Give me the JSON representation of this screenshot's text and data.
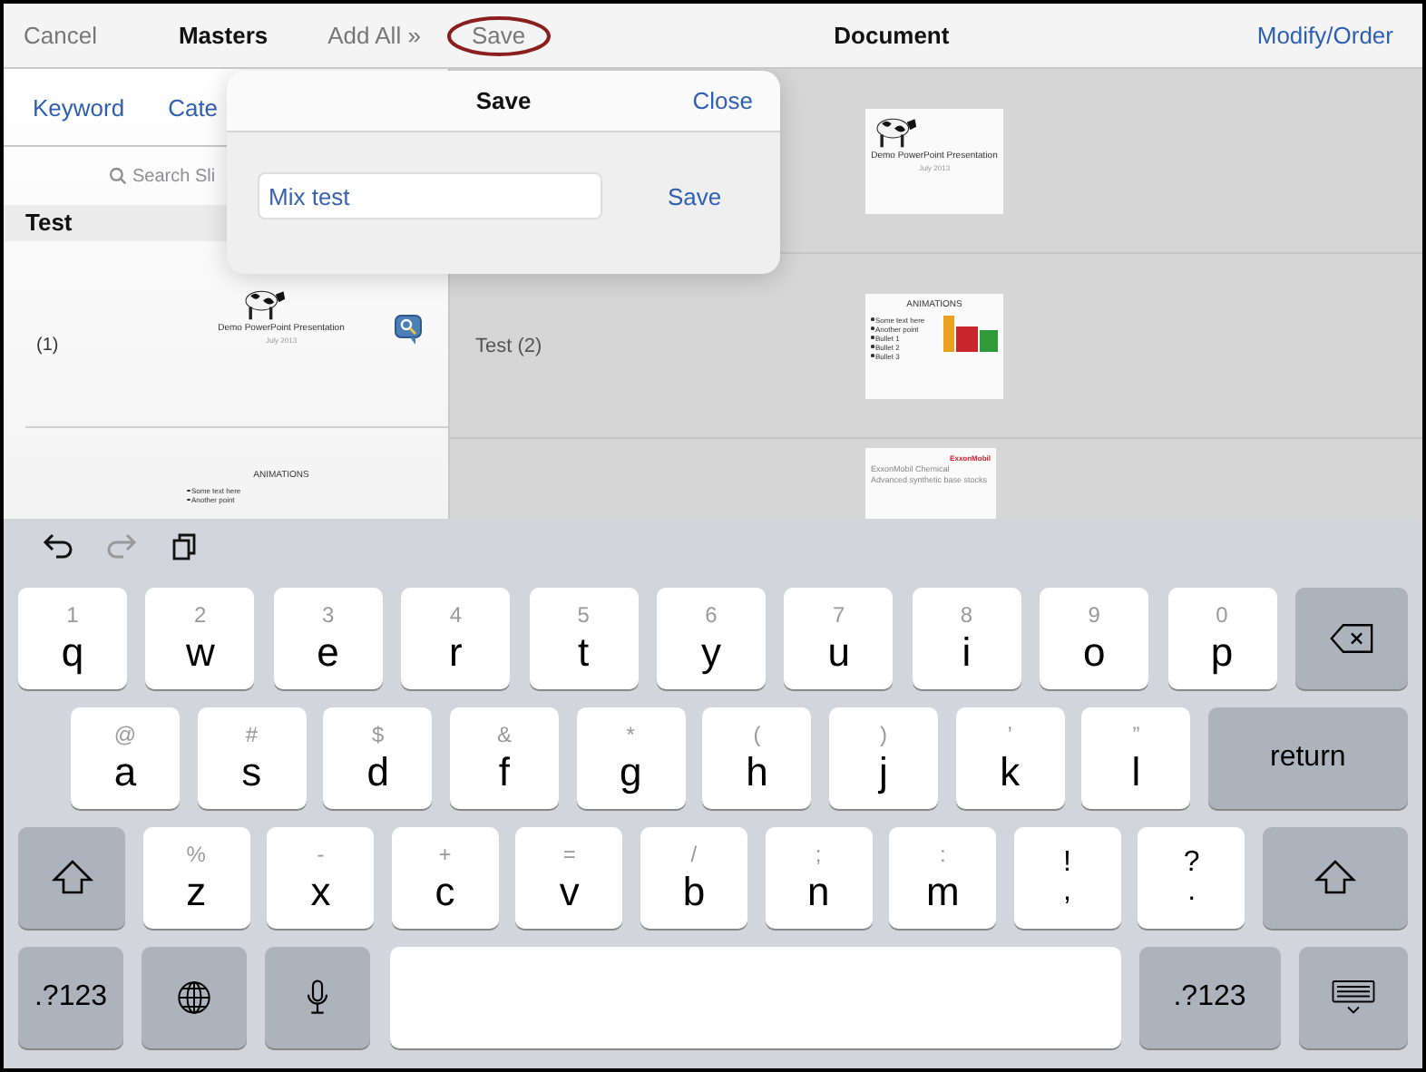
{
  "top_bar": {
    "cancel": "Cancel",
    "masters": "Masters",
    "add_all": "Add All »",
    "save": "Save",
    "save_highlighted": true,
    "document": "Document",
    "modify_order": "Modify/Order"
  },
  "filter_tabs": [
    "Keyword",
    "Cate"
  ],
  "search": {
    "placeholder": "Search Sli"
  },
  "section": "Test",
  "left_rows": [
    {
      "number": "(1)",
      "slide": {
        "kind": "title",
        "title": "Demo PowerPoint Presentation",
        "subtitle": "July 2013"
      }
    },
    {
      "slide": {
        "kind": "bullets",
        "title": "ANIMATIONS",
        "bullets": [
          "Some text here",
          "Another point"
        ]
      }
    }
  ],
  "right_rows": [
    {
      "slide": {
        "kind": "title",
        "title": "Demo PowerPoint Presentation",
        "subtitle": "July 2013"
      }
    },
    {
      "label": "Test (2)",
      "slide": {
        "kind": "bullets",
        "title": "ANIMATIONS",
        "bullets": [
          "Some text here",
          "Another point",
          "Bullet 1",
          "Bullet 2",
          "Bullet 3"
        ]
      }
    },
    {
      "slide": {
        "kind": "cover",
        "logo": "ExxonMobil",
        "title": "ExxonMobil Chemical",
        "subtitle": "Advanced synthetic base stocks"
      }
    }
  ],
  "popover": {
    "title": "Save",
    "close": "Close",
    "name_value": "Mix test",
    "save": "Save"
  },
  "keyboard": {
    "toolbar": [
      {
        "kind": "undo",
        "disabled": false
      },
      {
        "kind": "redo",
        "disabled": true
      },
      {
        "kind": "paste",
        "disabled": false
      }
    ],
    "rows": [
      {
        "keys": [
          {
            "kind": "letter",
            "main": "q",
            "alt": "1"
          },
          {
            "kind": "letter",
            "main": "w",
            "alt": "2"
          },
          {
            "kind": "letter",
            "main": "e",
            "alt": "3"
          },
          {
            "kind": "letter",
            "main": "r",
            "alt": "4"
          },
          {
            "kind": "letter",
            "main": "t",
            "alt": "5"
          },
          {
            "kind": "letter",
            "main": "y",
            "alt": "6"
          },
          {
            "kind": "letter",
            "main": "u",
            "alt": "7"
          },
          {
            "kind": "letter",
            "main": "i",
            "alt": "8"
          },
          {
            "kind": "letter",
            "main": "o",
            "alt": "9"
          },
          {
            "kind": "letter",
            "main": "p",
            "alt": "0"
          },
          {
            "kind": "delete"
          }
        ]
      },
      {
        "keys": [
          {
            "kind": "letter",
            "main": "a",
            "alt": "@"
          },
          {
            "kind": "letter",
            "main": "s",
            "alt": "#"
          },
          {
            "kind": "letter",
            "main": "d",
            "alt": "$"
          },
          {
            "kind": "letter",
            "main": "f",
            "alt": "&"
          },
          {
            "kind": "letter",
            "main": "g",
            "alt": "*"
          },
          {
            "kind": "letter",
            "main": "h",
            "alt": "("
          },
          {
            "kind": "letter",
            "main": "j",
            "alt": ")"
          },
          {
            "kind": "letter",
            "main": "k",
            "alt": "’"
          },
          {
            "kind": "letter",
            "main": "l",
            "alt": "”"
          },
          {
            "kind": "label",
            "main": "return"
          }
        ]
      },
      {
        "keys": [
          {
            "kind": "shift"
          },
          {
            "kind": "letter",
            "main": "z",
            "alt": "%"
          },
          {
            "kind": "letter",
            "main": "x",
            "alt": "-"
          },
          {
            "kind": "letter",
            "main": "c",
            "alt": "+"
          },
          {
            "kind": "letter",
            "main": "v",
            "alt": "="
          },
          {
            "kind": "letter",
            "main": "b",
            "alt": "/"
          },
          {
            "kind": "letter",
            "main": "n",
            "alt": ";"
          },
          {
            "kind": "letter",
            "main": "m",
            "alt": ":"
          },
          {
            "kind": "punct",
            "main": ",",
            "alt": "!"
          },
          {
            "kind": "punct",
            "main": ".",
            "alt": "?"
          },
          {
            "kind": "shift"
          }
        ]
      },
      {
        "keys": [
          {
            "kind": "label",
            "main": ".?123"
          },
          {
            "kind": "globe"
          },
          {
            "kind": "mic"
          },
          {
            "kind": "space"
          },
          {
            "kind": "label",
            "main": ".?123"
          },
          {
            "kind": "hide"
          }
        ]
      }
    ]
  }
}
